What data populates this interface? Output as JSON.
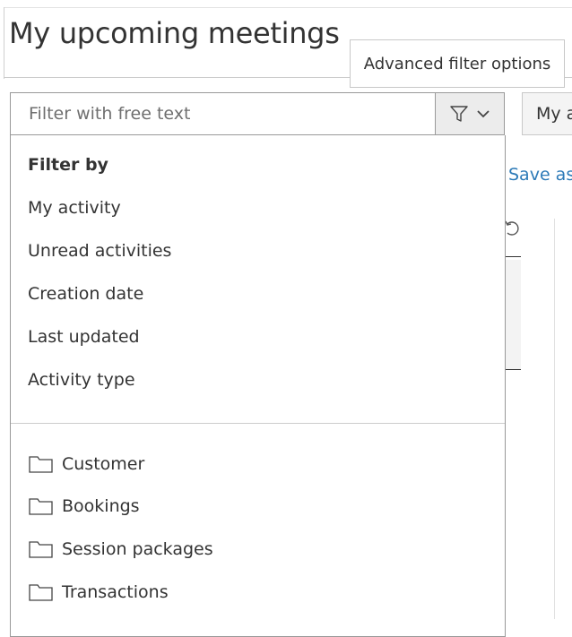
{
  "page": {
    "title": "My upcoming meetings"
  },
  "tooltip": {
    "text": "Advanced filter options"
  },
  "search": {
    "placeholder": "Filter with free text",
    "value": ""
  },
  "right_button": {
    "label": "My a"
  },
  "save_link": {
    "label": "Save as"
  },
  "dropdown": {
    "header": "Filter by",
    "items": [
      {
        "label": "My activity"
      },
      {
        "label": "Unread activities"
      },
      {
        "label": "Creation date"
      },
      {
        "label": "Last updated"
      },
      {
        "label": "Activity type"
      }
    ],
    "folders": [
      {
        "label": "Customer",
        "icon": "folder-icon"
      },
      {
        "label": "Bookings",
        "icon": "folder-icon"
      },
      {
        "label": "Session packages",
        "icon": "folder-icon"
      },
      {
        "label": "Transactions",
        "icon": "folder-icon"
      }
    ]
  },
  "icons": {
    "filter": "filter-funnel-icon",
    "chevron": "chevron-down-icon",
    "refresh": "refresh-icon"
  },
  "colors": {
    "link": "#2e7bb8",
    "border": "#999999",
    "button_bg": "#ececec"
  }
}
